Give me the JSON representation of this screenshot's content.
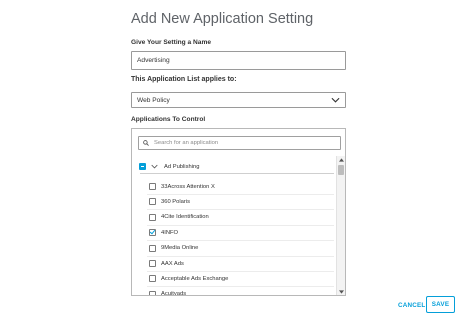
{
  "dialog": {
    "title": "Add New Application Setting"
  },
  "form": {
    "name_label": "Give Your Setting a Name",
    "name_value": "Advertising",
    "applies_label": "This Application List applies to:",
    "applies_selected": "Web Policy",
    "apps_label": "Applications To Control"
  },
  "apps": {
    "search_placeholder": "Search for an application",
    "group": {
      "label": "Ad Publishing",
      "state": "partial",
      "expanded": true
    },
    "items": [
      {
        "label": "33Across Attention X",
        "checked": false
      },
      {
        "label": "360 Polaris",
        "checked": false
      },
      {
        "label": "4Cite Identification",
        "checked": false
      },
      {
        "label": "4INFO",
        "checked": true
      },
      {
        "label": "9Media Online",
        "checked": false
      },
      {
        "label": "AAX Ads",
        "checked": false
      },
      {
        "label": "Acceptable Ads Exchange",
        "checked": false
      },
      {
        "label": "Acuityads",
        "checked": false
      }
    ]
  },
  "actions": {
    "cancel_label": "CANCEL",
    "save_label": "SAVE"
  },
  "colors": {
    "accent": "#049fd9",
    "title": "#5f6368",
    "border": "#9a9a9a"
  },
  "icons": {
    "search": "search-icon",
    "dropdown": "chevron-down-icon",
    "expand": "chevron-down-icon",
    "scroll_up": "arrow-up-icon",
    "scroll_down": "arrow-down-icon"
  }
}
